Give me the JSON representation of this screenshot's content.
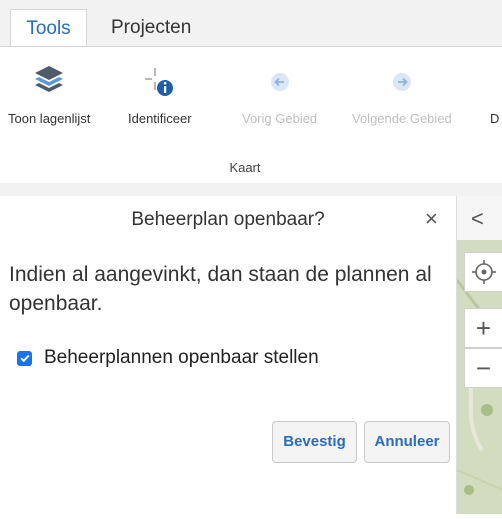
{
  "tabs": [
    {
      "label": "Tools",
      "active": true
    },
    {
      "label": "Projecten",
      "active": false
    }
  ],
  "ribbon": {
    "tools": [
      {
        "label": "Toon lagenlijst",
        "icon": "layers-icon",
        "enabled": true
      },
      {
        "label": "Identificeer",
        "icon": "identify-icon",
        "enabled": true
      },
      {
        "label": "Vorig Gebied",
        "icon": "arrow-left-icon",
        "enabled": false
      },
      {
        "label": "Volgende Gebied",
        "icon": "arrow-right-icon",
        "enabled": false
      },
      {
        "label": "D",
        "icon": "",
        "enabled": true
      }
    ],
    "group_label": "Kaart"
  },
  "dialog": {
    "title": "Beheerplan openbaar?",
    "close_glyph": "×",
    "message": "Indien al aangevinkt, dan staan de plannen al openbaar.",
    "checkbox_label": "Beheerplannen openbaar stellen",
    "checkbox_checked": true,
    "confirm_label": "Bevestig",
    "cancel_label": "Annuleer"
  },
  "map_controls": {
    "collapse_glyph": "<",
    "locate_icon": "locate-icon",
    "zoom_in_glyph": "+",
    "zoom_out_glyph": "−"
  },
  "colors": {
    "accent": "#2a6cbd",
    "checkbox": "#1a73e8",
    "disabled_text": "#bfbfbf",
    "tabstrip_bg": "#f2f2f2",
    "map_green": "#d2dcbf"
  }
}
